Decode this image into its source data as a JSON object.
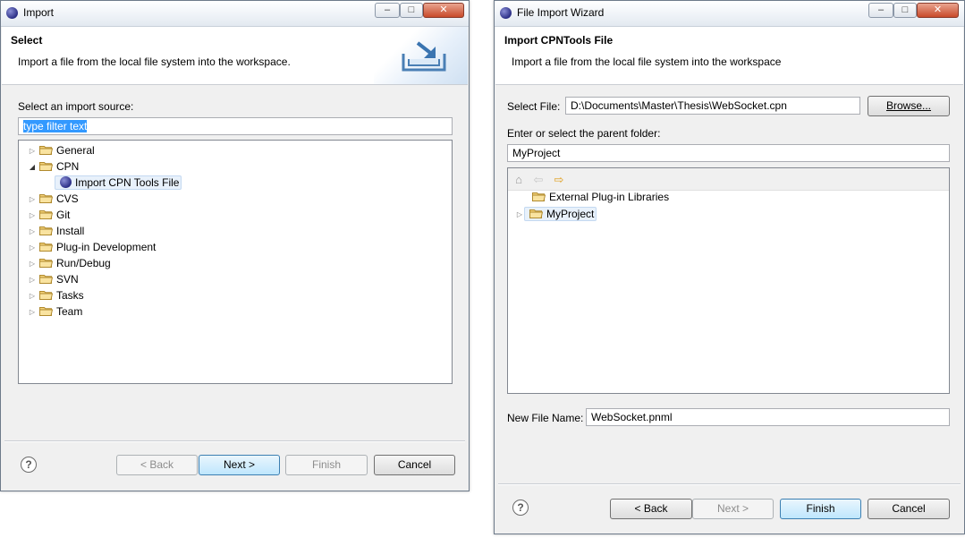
{
  "import_dialog": {
    "title": "Import",
    "header_title": "Select",
    "header_description": "Import a file from the local file system into the workspace.",
    "source_label": "Select an import source:",
    "filter_text": "type filter text",
    "tree": [
      {
        "label": "General"
      },
      {
        "label": "CPN"
      },
      {
        "label": "Import CPN Tools File"
      },
      {
        "label": "CVS"
      },
      {
        "label": "Git"
      },
      {
        "label": "Install"
      },
      {
        "label": "Plug-in Development"
      },
      {
        "label": "Run/Debug"
      },
      {
        "label": "SVN"
      },
      {
        "label": "Tasks"
      },
      {
        "label": "Team"
      }
    ],
    "buttons": {
      "back": "< Back",
      "next": "Next >",
      "finish": "Finish",
      "cancel": "Cancel"
    }
  },
  "wizard_dialog": {
    "title": "File Import Wizard",
    "header_title": "Import CPNTools File",
    "header_description": "Import a file from the local file system into the workspace",
    "select_file_label": "Select File:",
    "select_file_value": "D:\\Documents\\Master\\Thesis\\WebSocket.cpn",
    "browse": "Browse...",
    "parent_folder_label": "Enter or select the parent folder:",
    "parent_folder_value": "MyProject",
    "tree": [
      {
        "label": "External Plug-in Libraries"
      },
      {
        "label": "MyProject"
      }
    ],
    "new_file_label": "New File Name:",
    "new_file_value": "WebSocket.pnml",
    "buttons": {
      "back": "< Back",
      "next": "Next >",
      "finish": "Finish",
      "cancel": "Cancel"
    }
  },
  "colors": {
    "selection": "#3399ff",
    "folder": "#e8c060",
    "accent_default_button": "#3c7fb1"
  }
}
